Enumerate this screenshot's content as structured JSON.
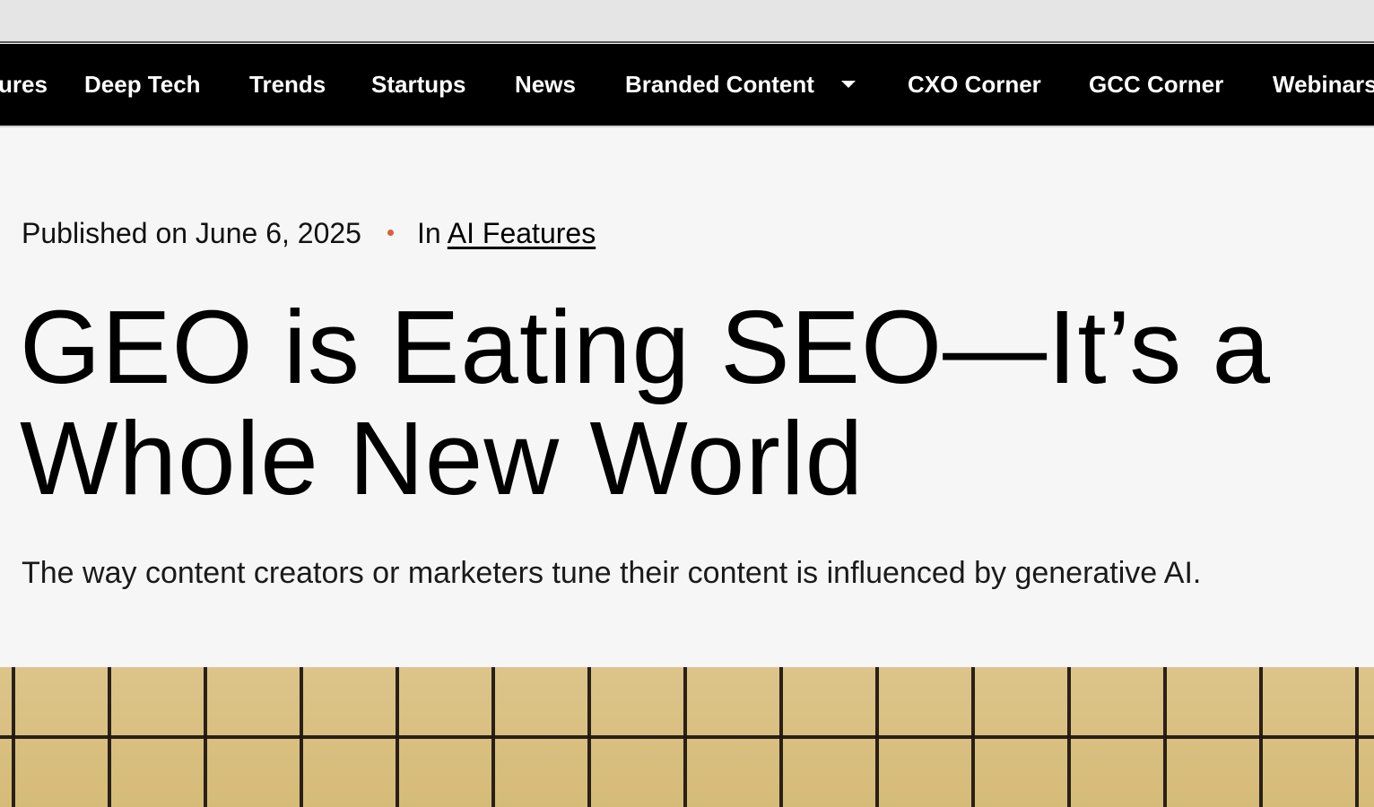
{
  "nav": {
    "items": [
      {
        "label": "ures"
      },
      {
        "label": "Deep Tech"
      },
      {
        "label": "Trends"
      },
      {
        "label": "Startups"
      },
      {
        "label": "News"
      },
      {
        "label": "Branded Content"
      },
      {
        "label": "CXO Corner"
      },
      {
        "label": "GCC Corner"
      },
      {
        "label": "Webinars"
      }
    ],
    "dropdown_icon": "caret-down-icon"
  },
  "article": {
    "published": "Published on June 6, 2025",
    "category_prefix": "In",
    "category": "AI Features",
    "title": "GEO is Eating SEO—It’s a Whole New World",
    "subtitle": "The way content creators or marketers tune their content is influenced by generative AI."
  },
  "colors": {
    "nav_bg": "#000000",
    "accent_dot": "#d9603a",
    "page_bg": "#f6f6f6",
    "hero_tile": "#d8be7c"
  }
}
